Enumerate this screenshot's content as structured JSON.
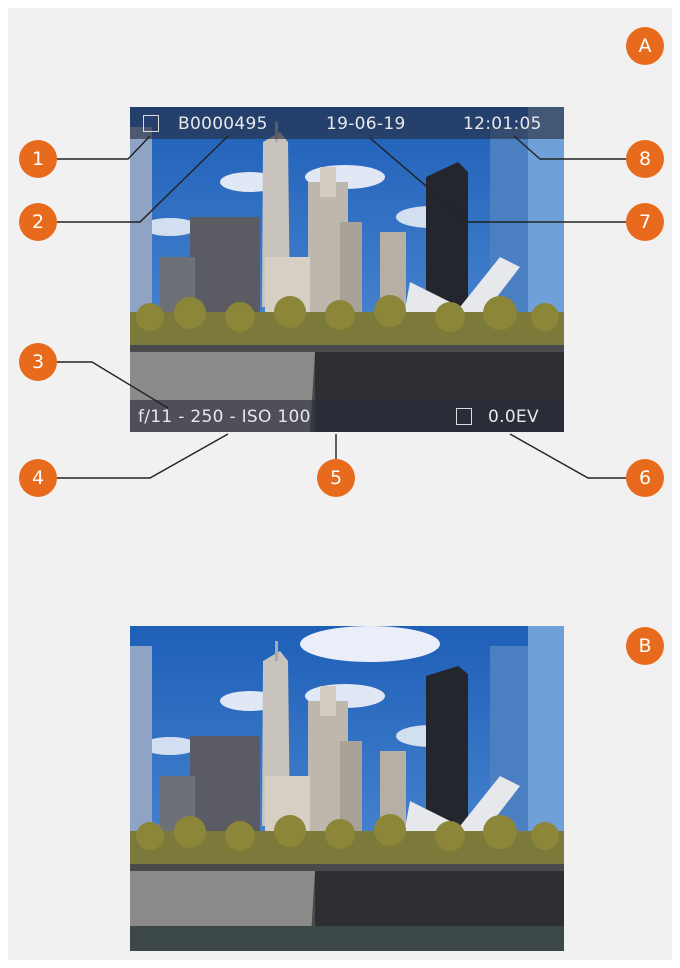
{
  "panels": [
    {
      "label": "A"
    },
    {
      "label": "B"
    }
  ],
  "osd": {
    "file_number": "B0000495",
    "date": "19-06-19",
    "time": "12:01:05",
    "exposure": "f/11 - 250 - ISO 100",
    "exposure_comp": "0.0EV"
  },
  "callouts": [
    "1",
    "2",
    "3",
    "4",
    "5",
    "6",
    "7",
    "8"
  ],
  "colors": {
    "badge": "#e86a1c",
    "panel_background": "#f1f1f1",
    "osd_bar": "#2c3040",
    "leader_line": "#222222"
  },
  "icons": {
    "protect": "folder-protect-icon",
    "metering": "metering-mode-icon"
  }
}
